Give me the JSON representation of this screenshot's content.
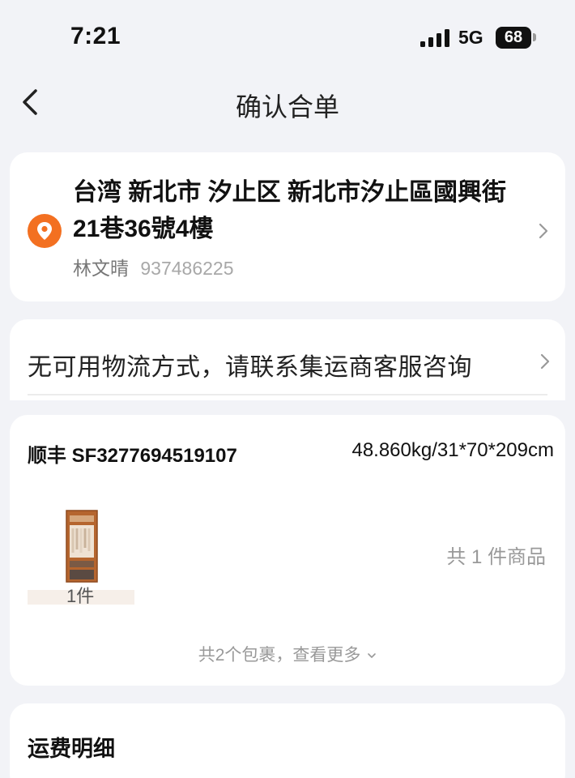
{
  "status_bar": {
    "time": "7:21",
    "network": "5G",
    "battery": "68"
  },
  "nav": {
    "title": "确认合单",
    "back_icon": "chevron-left-icon"
  },
  "address": {
    "full_address": "台湾 新北市 汐止区  新北市汐止區國興街21巷36號4樓",
    "name": "林文晴",
    "phone": "937486225",
    "pin_color": "#f37021"
  },
  "logistics": {
    "message": "无可用物流方式，请联系集运商客服咨询"
  },
  "package": {
    "carrier": "顺丰 SF3277694519107",
    "weight_dims": "48.860kg/31*70*209cm",
    "item_qty": "1件",
    "item_count": "共 1 件商品",
    "more_link": "共2个包裹，查看更多"
  },
  "fees": {
    "title": "运费明细"
  }
}
